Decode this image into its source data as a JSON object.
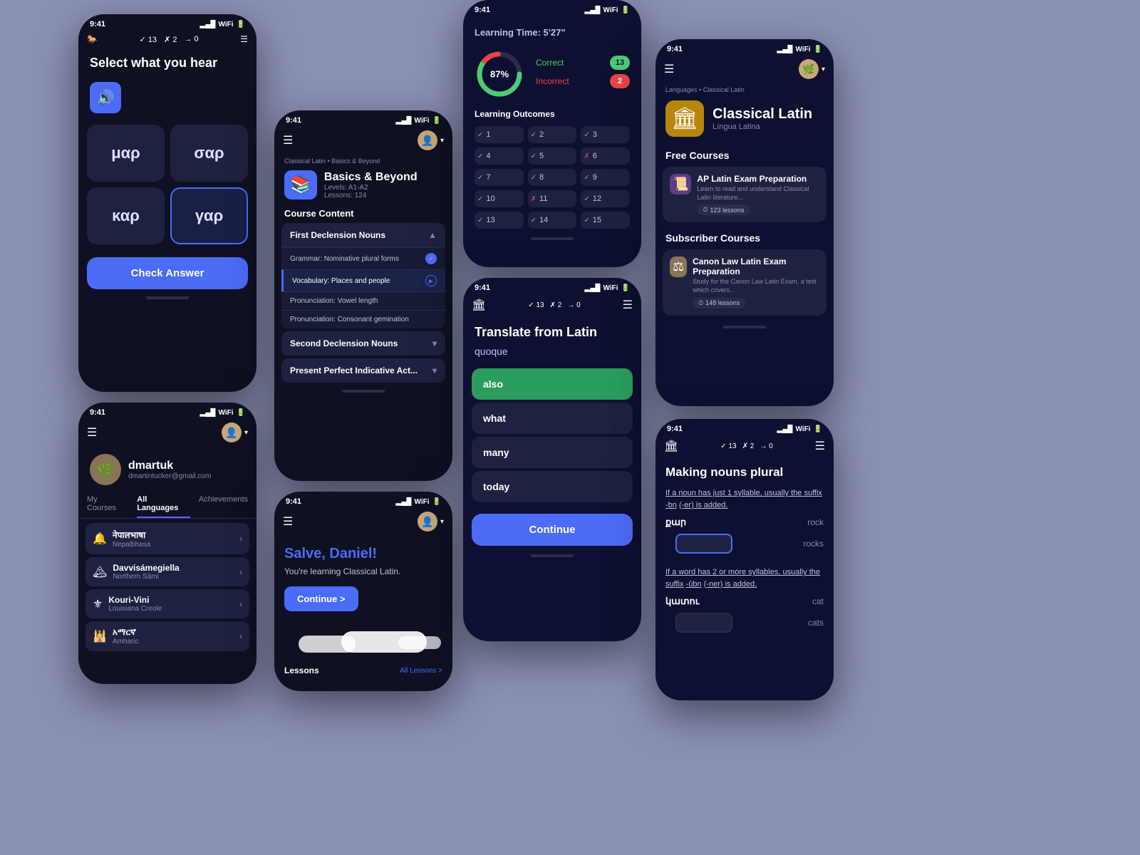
{
  "phone1": {
    "time": "9:41",
    "title": "Select what you hear",
    "stats": {
      "checks": "13",
      "crosses": "2",
      "arrows": "0"
    },
    "answers": [
      {
        "text": "μαρ",
        "selected": false
      },
      {
        "text": "σαρ",
        "selected": false
      },
      {
        "text": "καρ",
        "selected": false
      },
      {
        "text": "γαρ",
        "selected": true
      }
    ],
    "check_label": "Check Answer"
  },
  "phone2": {
    "time": "9:41",
    "username": "dmartuk",
    "email": "dmartintucker@gmail.com",
    "tabs": [
      "My Courses",
      "All Languages",
      "Achievements"
    ],
    "active_tab": "All Languages",
    "languages": [
      {
        "name": "नेपालभाषा",
        "sub": "Nepalbhasa",
        "icon": "🔔"
      },
      {
        "name": "Davvisámegiella",
        "sub": "Northern Sámi",
        "icon": "🏔"
      },
      {
        "name": "Kouri-Vini",
        "sub": "Louisiana Creole",
        "icon": "⚜"
      },
      {
        "name": "አማርኛ",
        "sub": "Amharic",
        "icon": "🕌"
      }
    ]
  },
  "phone3": {
    "time": "9:41",
    "breadcrumb": "Classical Latin • Basics & Beyond",
    "course_icon": "📚",
    "course_title": "Basics & Beyond",
    "course_levels": "Levels: A1-A2",
    "course_lessons": "Lessons: 124",
    "section": "Course Content",
    "accordion1": {
      "title": "First Declension Nouns",
      "items": [
        {
          "label": "Grammar: Nominative plural forms",
          "done": true
        },
        {
          "label": "Vocabulary: Places and people",
          "active": true
        },
        {
          "label": "Pronunciation: Vowel length",
          "done": false
        },
        {
          "label": "Pronunciation: Consonant gemination",
          "done": false
        }
      ]
    },
    "accordion2": {
      "title": "Second Declension Nouns"
    },
    "accordion3": {
      "title": "Present Perfect Indicative Act..."
    }
  },
  "phone4": {
    "time": "9:41",
    "greeting": "Salve, Daniel!",
    "subtext": "You're learning Classical Latin.",
    "continue_label": "Continue >",
    "lessons_label": "Lessons",
    "all_lessons_label": "All Lessons >"
  },
  "phone5": {
    "header": "Learning Time: 5'27\"",
    "percent": "87%",
    "correct_label": "Correct",
    "correct_count": "13",
    "incorrect_label": "Incorrect",
    "incorrect_count": "2",
    "outcomes_title": "Learning Outcomes",
    "outcomes": [
      {
        "num": "1",
        "correct": true
      },
      {
        "num": "2",
        "correct": true
      },
      {
        "num": "3",
        "correct": true
      },
      {
        "num": "4",
        "correct": true
      },
      {
        "num": "5",
        "correct": true
      },
      {
        "num": "6",
        "correct": false
      },
      {
        "num": "7",
        "correct": true
      },
      {
        "num": "8",
        "correct": true
      },
      {
        "num": "9",
        "correct": true
      },
      {
        "num": "10",
        "correct": true
      },
      {
        "num": "11",
        "correct": false
      },
      {
        "num": "12",
        "correct": true
      },
      {
        "num": "13",
        "correct": true
      },
      {
        "num": "14",
        "correct": true
      },
      {
        "num": "15",
        "correct": true
      }
    ]
  },
  "phone6": {
    "time": "9:41",
    "stats": {
      "checks": "13",
      "crosses": "2",
      "arrows": "0"
    },
    "title": "Translate from Latin",
    "word": "quoque",
    "options": [
      {
        "text": "also",
        "selected": true
      },
      {
        "text": "what",
        "selected": false
      },
      {
        "text": "many",
        "selected": false
      },
      {
        "text": "today",
        "selected": false
      }
    ],
    "continue_label": "Continue"
  },
  "phone7": {
    "time": "9:41",
    "breadcrumb": "Languages • Classical Latin",
    "course_icon": "🏛",
    "course_title": "Classical Latin",
    "course_subtitle": "Língua Latina",
    "free_courses_label": "Free Courses",
    "courses": [
      {
        "icon": "📜",
        "title": "AP Latin Exam Preparation",
        "desc": "Learn to read and understand Classical Latin literature...",
        "badge": "123 lessons"
      }
    ],
    "subscriber_label": "Subscriber Courses",
    "subscriber_courses": [
      {
        "icon": "⚖",
        "title": "Canon Law Latin Exam Preparation",
        "desc": "Study for the Canon Law Latin Exam, a test which covers...",
        "badge": "148 lessons"
      }
    ]
  },
  "phone8": {
    "time": "9:41",
    "stats": {
      "checks": "13",
      "crosses": "2",
      "arrows": "0"
    },
    "title": "Making nouns plural",
    "body1": "If a noun has just 1 syllable, usually the suffix",
    "suffix1": "-bn",
    "body1b": "(-er) is added.",
    "word1_am": "քար",
    "word1_en": "rock",
    "word1_plural_en": "rocks",
    "body2": "If a word has 2 or more syllables, usually the suffix",
    "suffix2": "-ûbn",
    "body2b": "(-ner) is added.",
    "word2_am": "կատու",
    "word2_en": "cat",
    "word2_plural_en": "cats"
  }
}
